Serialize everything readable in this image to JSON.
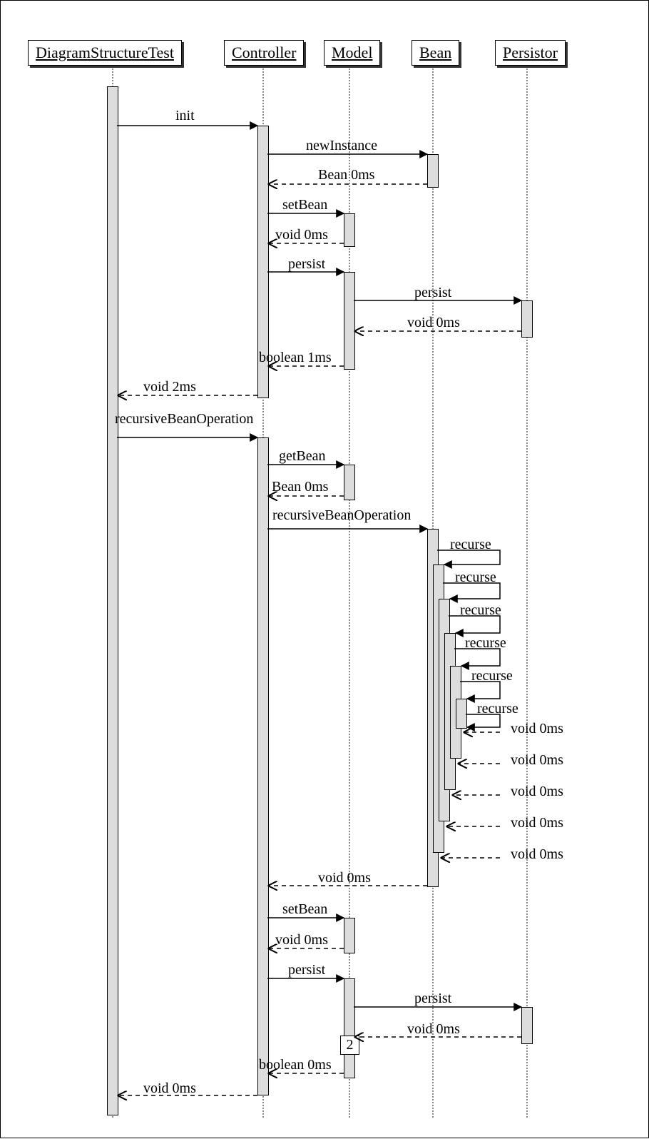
{
  "participants": {
    "p0": "DiagramStructureTest",
    "p1": "Controller",
    "p2": "Model",
    "p3": "Bean",
    "p4": "Persistor"
  },
  "messages": {
    "init": "init",
    "newInstance": "newInstance",
    "beanRet": "Bean 0ms",
    "setBean": "setBean",
    "voidRet0": "void 0ms",
    "persist": "persist",
    "booleanRet1": "boolean 1ms",
    "voidRet2": "void 2ms",
    "recOp": "recursiveBeanOperation",
    "getBean": "getBean",
    "recurse": "recurse",
    "booleanRet0": "boolean 0ms",
    "linkNote": "2"
  }
}
